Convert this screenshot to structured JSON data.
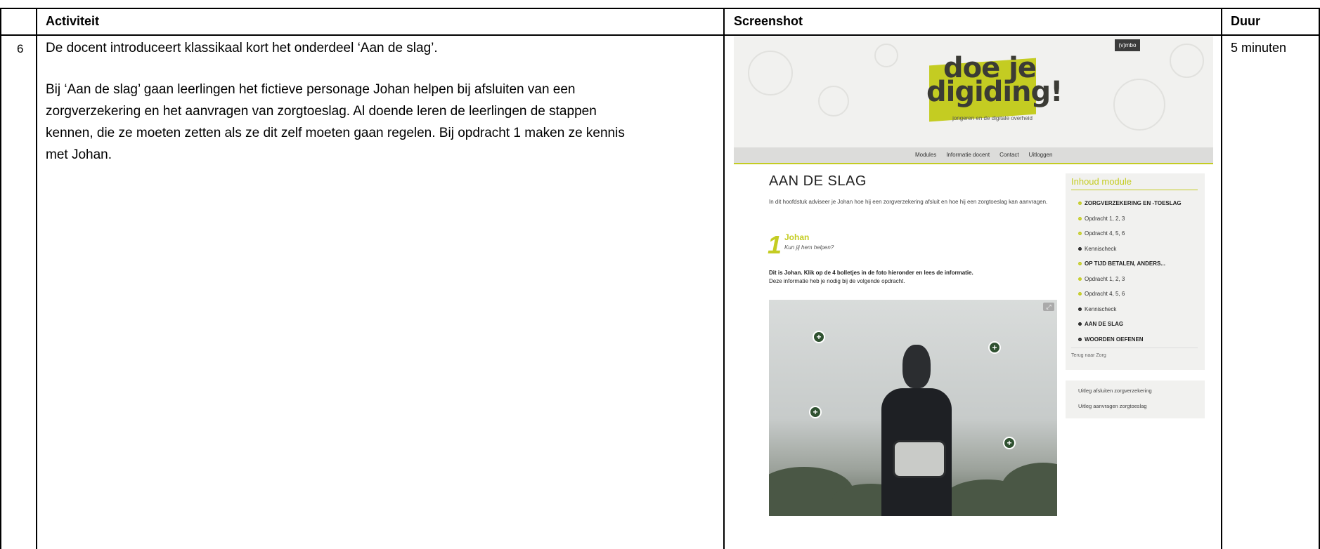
{
  "table": {
    "headers": {
      "activity": "Activiteit",
      "screenshot": "Screenshot",
      "duration": "Duur"
    },
    "row": {
      "number": "6",
      "paragraph1": "De docent introduceert klassikaal kort het onderdeel ‘Aan de slag’.",
      "paragraph2_lines": [
        "Bij ‘Aan de slag’ gaan leerlingen het fictieve personage Johan helpen bij afsluiten van een",
        "zorgverzekering en het aanvragen van zorgtoeslag. Al doende leren de leerlingen de stappen",
        "kennen, die ze moeten zetten als ze dit zelf moeten gaan regelen. Bij opdracht 1 maken ze kennis",
        "met Johan."
      ],
      "duration": "5 minuten"
    }
  },
  "screenshot": {
    "badge": "(v)mbo",
    "logo": {
      "line1": "doe je",
      "line2": "digiding!",
      "tagline": "jongeren en de digitale overheid"
    },
    "menu": [
      "Modules",
      "Informatie docent",
      "Contact",
      "Uitloggen"
    ],
    "page_title": "AAN DE SLAG",
    "intro": "In dit hoofdstuk adviseer je Johan hoe hij een zorgverzekering afsluit en hoe hij een zorgtoeslag kan aanvragen.",
    "step": {
      "number": "1",
      "title": "Johan",
      "subtitle": "Kun jij hem helpen?"
    },
    "instruction_bold": "Dit is Johan. Klik op de 4 bolletjes in de foto hieronder en lees de informatie.",
    "instruction": "Deze informatie heb je nodig bij de volgende opdracht.",
    "sidebar": {
      "title": "Inhoud module",
      "items": [
        {
          "label": "ZORGVERZEKERING EN -TOESLAG",
          "bold": true,
          "dot": "accent"
        },
        {
          "label": "Opdracht 1, 2, 3",
          "bold": false,
          "dot": "accent"
        },
        {
          "label": "Opdracht 4, 5, 6",
          "bold": false,
          "dot": "accent"
        },
        {
          "label": "Kennischeck",
          "bold": false,
          "dot": "dark"
        },
        {
          "label": "OP TIJD BETALEN, ANDERS...",
          "bold": true,
          "dot": "accent"
        },
        {
          "label": "Opdracht 1, 2, 3",
          "bold": false,
          "dot": "accent"
        },
        {
          "label": "Opdracht 4, 5, 6",
          "bold": false,
          "dot": "accent"
        },
        {
          "label": "Kennischeck",
          "bold": false,
          "dot": "dark"
        },
        {
          "label": "AAN DE SLAG",
          "bold": true,
          "dot": "dark"
        },
        {
          "label": "WOORDEN OEFENEN",
          "bold": true,
          "dot": "dark"
        }
      ],
      "back_link": "Terug naar Zorg"
    },
    "links": [
      "Uitleg afsluiten zorgverzekering",
      "Uitleg aanvragen zorgtoeslag"
    ],
    "colors": {
      "accent": "#c4cc22",
      "hotspot": "#2f5130",
      "panel": "#f1f1ef"
    }
  }
}
